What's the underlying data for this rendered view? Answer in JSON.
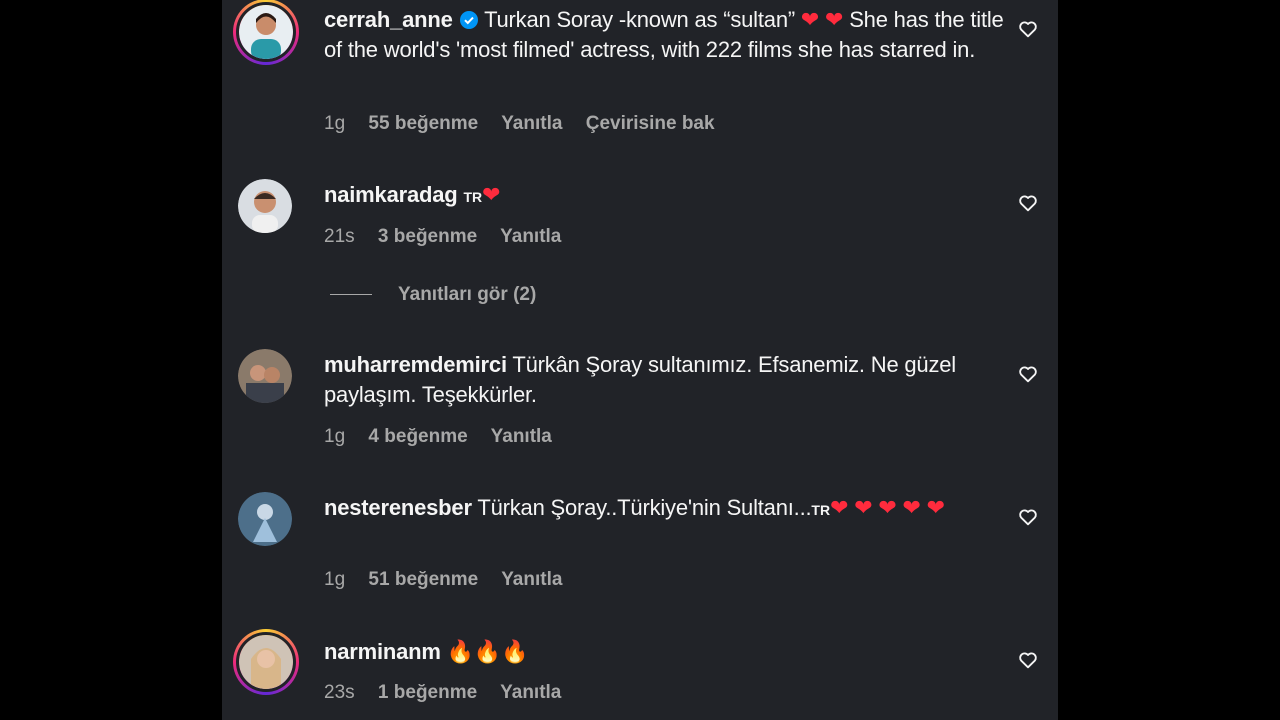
{
  "comments": [
    {
      "username": "cerrah_anne",
      "verified": true,
      "text_before": "Turkan Soray -known as “sultan” ",
      "text_after": " She has the title of the world's 'most filmed' actress, with 222 films she has starred in.",
      "time": "1g",
      "likes": "55 beğenme",
      "reply": "Yanıtla",
      "translate": "Çevirisine bak",
      "avatar_icon": "avatar-story-ring"
    },
    {
      "username": "naimkaradag",
      "flag": "TR",
      "time": "21s",
      "likes": "3 beğenme",
      "reply": "Yanıtla"
    },
    {
      "username": "muharremdemirci",
      "text": "Türkân Şoray sultanımız. Efsanemiz. Ne güzel paylaşım. Teşekkürler.",
      "time": "1g",
      "likes": "4 beğenme",
      "reply": "Yanıtla"
    },
    {
      "username": "nesterenesber",
      "text": "Türkan Şoray..Türkiye'nin Sultanı...",
      "flag": "TR",
      "time": "1g",
      "likes": "51 beğenme",
      "reply": "Yanıtla"
    },
    {
      "username": "narminanm",
      "text": "🔥🔥🔥",
      "time": "23s",
      "likes": "1 beğenme",
      "reply": "Yanıtla"
    }
  ],
  "view_replies": "Yanıtları gör (2)",
  "colors": {
    "background": "#212328",
    "text": "#f5f5f5",
    "muted": "#a8a8a8",
    "heart": "#ff2b3d",
    "verified": "#0095f6"
  }
}
